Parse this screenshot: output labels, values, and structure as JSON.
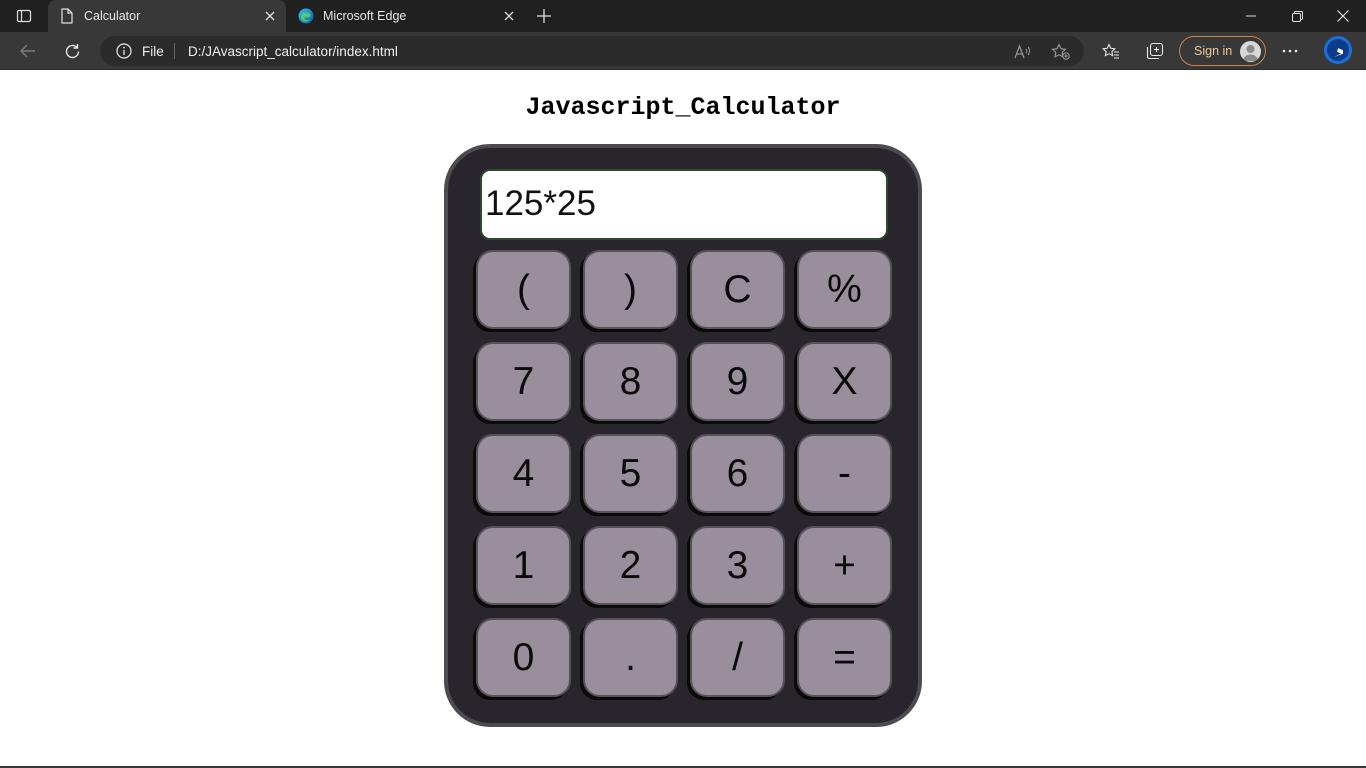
{
  "browser": {
    "tabs": [
      {
        "title": "Calculator",
        "active": true
      },
      {
        "title": "Microsoft Edge",
        "active": false
      }
    ],
    "address": {
      "scheme_label": "File",
      "url": "D:/JAvascript_calculator/index.html"
    },
    "signin_label": "Sign in",
    "colors": {
      "tabbar": "#202020",
      "toolbar": "#383838",
      "signin_border": "#c8854c"
    }
  },
  "page": {
    "title": "Javascript_Calculator"
  },
  "calculator": {
    "display_value": "125*25",
    "keys": [
      "(",
      ")",
      "C",
      "%",
      "7",
      "8",
      "9",
      "X",
      "4",
      "5",
      "6",
      "-",
      "1",
      "2",
      "3",
      "+",
      "0",
      ".",
      "/",
      "="
    ],
    "colors": {
      "body": "#28262c",
      "key": "#998f9c",
      "display": "#ffffff"
    }
  }
}
